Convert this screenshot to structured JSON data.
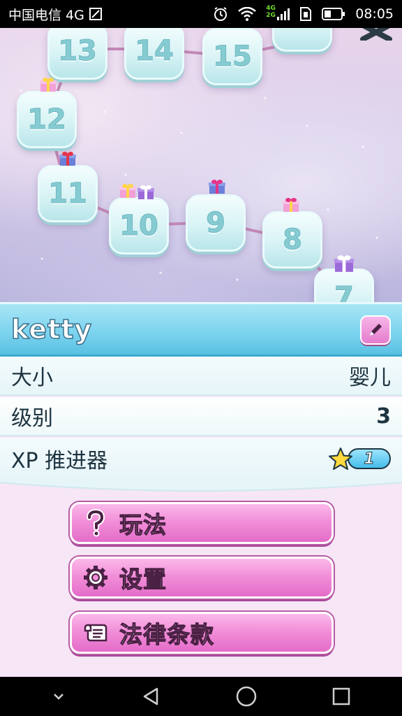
{
  "status_bar": {
    "carrier": "中国电信 4G",
    "time": "08:05",
    "network_labels": [
      "4G",
      "2G"
    ],
    "icons": [
      "sim-icon",
      "alarm-icon",
      "wifi-icon",
      "signal-icon",
      "battery-icon"
    ]
  },
  "map": {
    "levels": [
      "13",
      "14",
      "15",
      "12",
      "11",
      "10",
      "9",
      "8",
      "7"
    ],
    "close_icon": "close-icon"
  },
  "profile": {
    "name": "ketty",
    "edit_icon": "pencil-icon",
    "rows": {
      "size": {
        "label": "大小",
        "value": "婴儿"
      },
      "level": {
        "label": "级别",
        "value": "3"
      },
      "xp": {
        "label": "XP 推进器",
        "value": "1"
      }
    }
  },
  "menu": {
    "howto": {
      "label": "玩法",
      "icon": "question-icon"
    },
    "settings": {
      "label": "设置",
      "icon": "gear-icon"
    },
    "legal": {
      "label": "法律条款",
      "icon": "scroll-icon"
    }
  },
  "nav_bar": {
    "icons": [
      "collapse-chevron-icon",
      "back-icon",
      "home-icon",
      "recents-icon"
    ]
  },
  "colors": {
    "name_bar": "#79d2ee",
    "menu_button": "#f28fd9",
    "panel_bg": "#f6e6f6"
  }
}
